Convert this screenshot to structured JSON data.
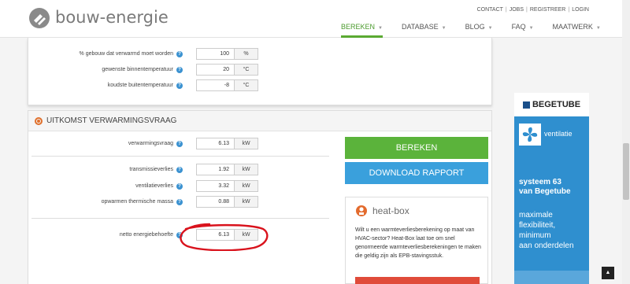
{
  "brand": {
    "name": "bouw-energie"
  },
  "topnav": {
    "contact": "CONTACT",
    "jobs": "JOBS",
    "registreer": "REGISTREER",
    "login": "LOGIN"
  },
  "mainnav": [
    {
      "label": "BEREKEN"
    },
    {
      "label": "DATABASE"
    },
    {
      "label": "BLOG"
    },
    {
      "label": "FAQ"
    },
    {
      "label": "MAATWERK"
    }
  ],
  "input_rows": [
    {
      "label": "% gebouw dat verwarmd moet worden",
      "value": "100",
      "unit": "%"
    },
    {
      "label": "gewenste binnentemperatuur",
      "value": "20",
      "unit": "°C"
    },
    {
      "label": "koudste buitentemperatuur",
      "value": "-8",
      "unit": "°C"
    }
  ],
  "result": {
    "title": "UITKOMST VERWARMINGSVRAAG",
    "rows": [
      {
        "label": "verwarmingsvraag",
        "value": "6.13",
        "unit": "kW"
      },
      {
        "label": "transmissieverlies",
        "value": "1.92",
        "unit": "kW"
      },
      {
        "label": "ventilatieverlies",
        "value": "3.32",
        "unit": "kW"
      },
      {
        "label": "opwarmen thermische massa",
        "value": "0.88",
        "unit": "kW"
      },
      {
        "label": "netto energiebehoefte",
        "value": "6.13",
        "unit": "kW"
      }
    ]
  },
  "buttons": {
    "calculate": "BEREKEN",
    "download": "DOWNLOAD RAPPORT"
  },
  "heatbox": {
    "title": "heat-box",
    "text": "Wilt u een warmteverliesberekening op maat van HVAC-sector? Heat-Box laat toe om snel genormeerde warmteverliesberekeningen te maken die geldig zijn als EPB-stavingsstuk."
  },
  "ad": {
    "brand": "BEGETUBE",
    "product": "ventilatie",
    "headline1": "systeem 63",
    "headline2": "van Begetube",
    "tag1": "maximale",
    "tag2": "flexibiliteit,",
    "tag3": "minimum",
    "tag4": "aan onderdelen"
  },
  "help_icon": "question-icon",
  "colors": {
    "green": "#5bb33b",
    "blue": "#3aa0dc",
    "orange": "#e0702c",
    "annotation_red": "#d9121c"
  }
}
